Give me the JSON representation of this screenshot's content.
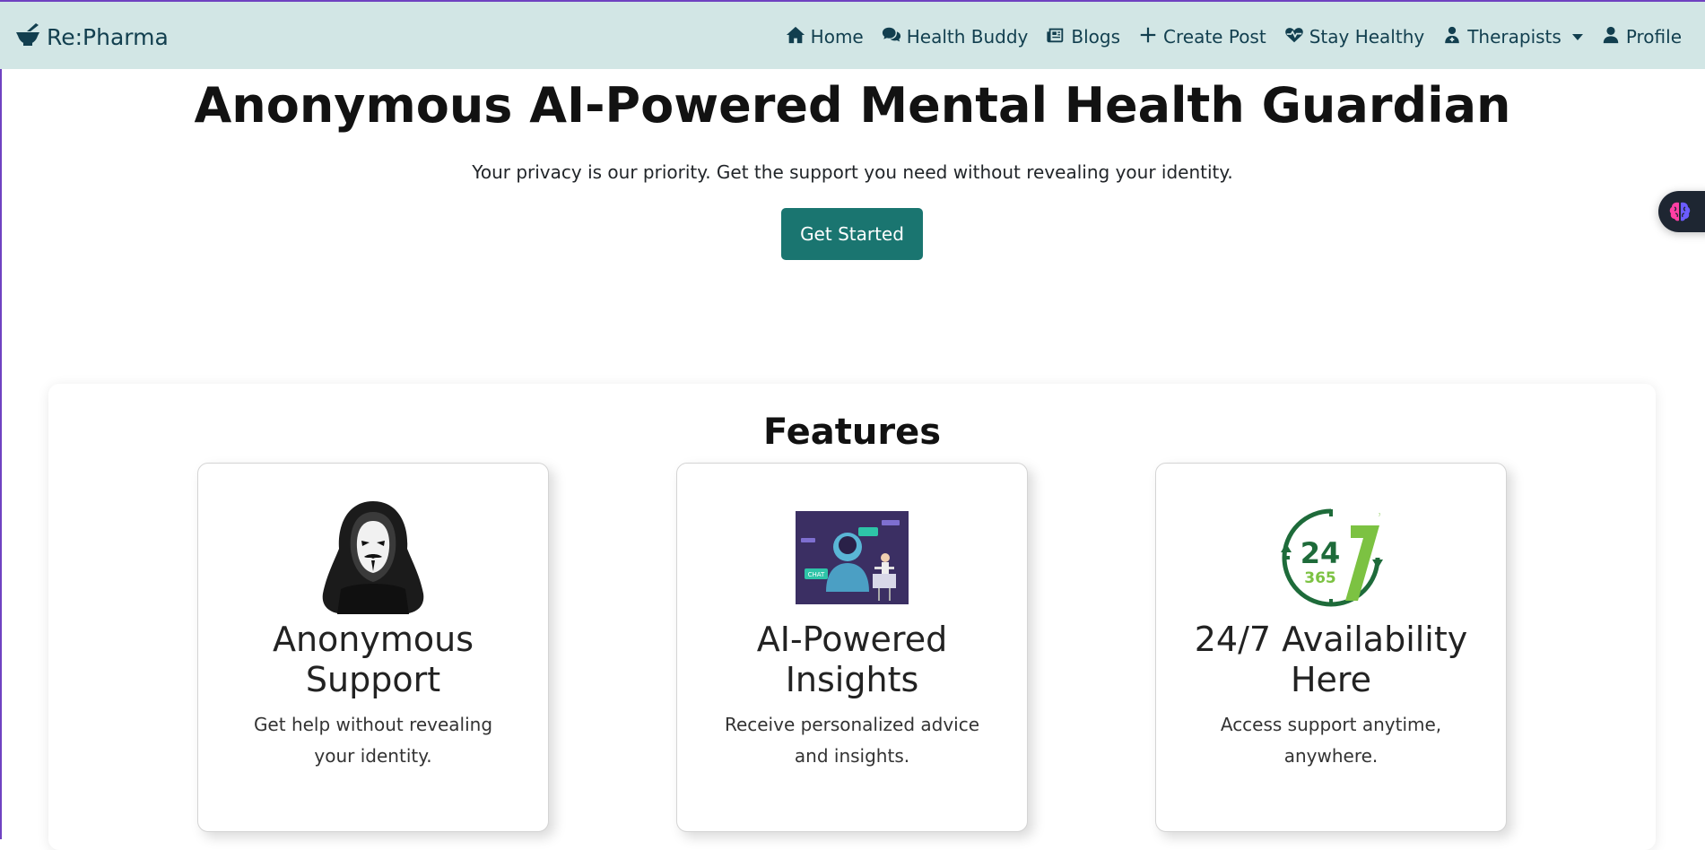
{
  "brand": {
    "name": "Re:Pharma",
    "icon": "mortar-pestle-icon"
  },
  "nav": {
    "items": [
      {
        "label": "Home",
        "icon": "home-icon"
      },
      {
        "label": "Health Buddy",
        "icon": "chat-bubbles-icon"
      },
      {
        "label": "Blogs",
        "icon": "newspaper-icon"
      },
      {
        "label": "Create Post",
        "icon": "plus-icon"
      },
      {
        "label": "Stay Healthy",
        "icon": "heart-pulse-icon"
      },
      {
        "label": "Therapists",
        "icon": "doctor-icon"
      },
      {
        "label": "Profile",
        "icon": "user-icon"
      }
    ]
  },
  "hero": {
    "title": "Anonymous AI-Powered Mental Health Guardian",
    "subtitle": "Your privacy is our priority. Get the support you need without revealing your identity.",
    "cta_label": "Get Started"
  },
  "features": {
    "title": "Features",
    "cards": [
      {
        "title": "Anonymous Support",
        "description": "Get help without revealing your identity.",
        "image": "hooded-mask-figure"
      },
      {
        "title": "AI-Powered Insights",
        "description": "Receive personalized advice and insights.",
        "image": "ai-chat-illustration",
        "image_text": "CHAT"
      },
      {
        "title": "24/7 Availability Here",
        "description": "Access support anytime, anywhere.",
        "image": "24-7-365-clock",
        "image_text": [
          "24",
          "7",
          "365"
        ]
      }
    ]
  },
  "colors": {
    "navbar_bg": "#d2e6e5",
    "brand_text": "#123f4f",
    "cta_bg": "#1a7570",
    "accent_line": "#6f42c1"
  }
}
